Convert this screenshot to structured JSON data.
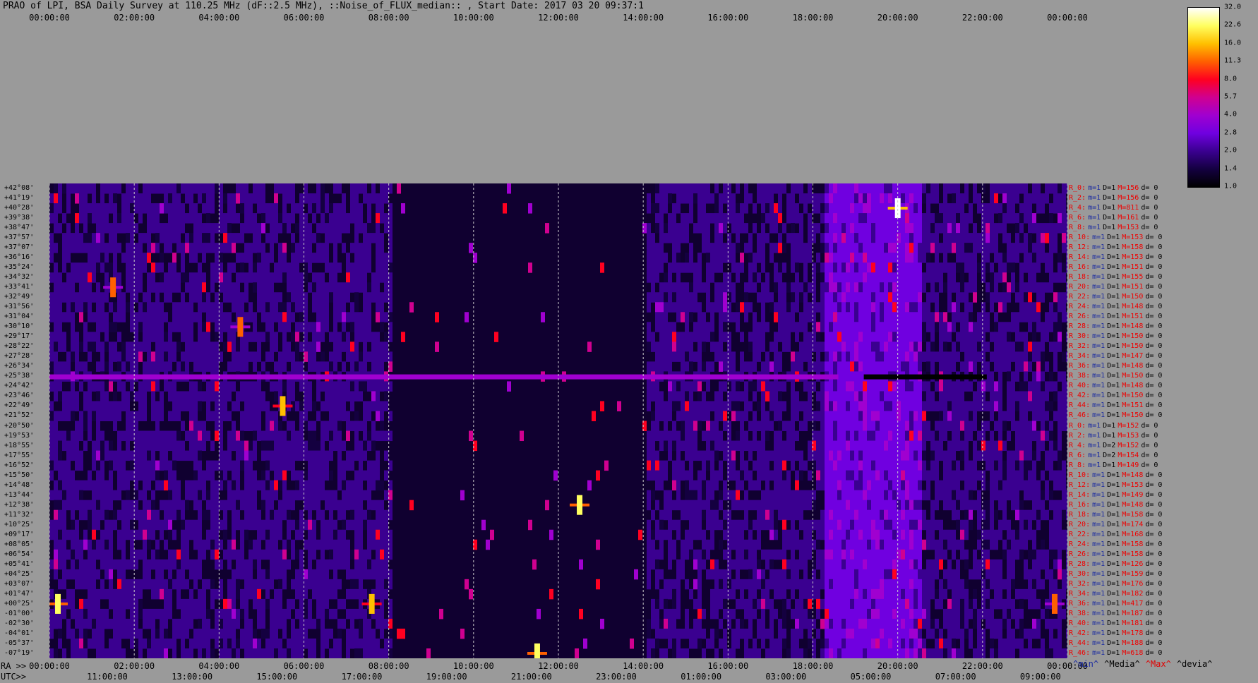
{
  "title": "PRAO of LPI, BSA Daily Survey at 110.25 MHz (dF::2.5 MHz), ::Noise_of_FLUX_median:: , Start Date: 2017 03 20 09:37:1",
  "chart_data": {
    "type": "heatmap",
    "x_top_ticks": [
      "00:00:00",
      "02:00:00",
      "04:00:00",
      "06:00:00",
      "08:00:00",
      "10:00:00",
      "12:00:00",
      "14:00:00",
      "16:00:00",
      "18:00:00",
      "20:00:00",
      "22:00:00",
      "00:00:00"
    ],
    "ra_label": "RA >>",
    "ra_ticks": [
      "00:00:00",
      "02:00:00",
      "04:00:00",
      "06:00:00",
      "08:00:00",
      "10:00:00",
      "12:00:00",
      "14:00:00",
      "16:00:00",
      "18:00:00",
      "20:00:00",
      "22:00:00",
      "00:00:00"
    ],
    "utc_label": "UTC>>",
    "utc_ticks": [
      "11:00:00",
      "13:00:00",
      "15:00:00",
      "17:00:00",
      "19:00:00",
      "21:00:00",
      "23:00:00",
      "01:00:00",
      "03:00:00",
      "05:00:00",
      "07:00:00",
      "09:00:00"
    ],
    "colorbar": {
      "ticks": [
        "32.0",
        "22.6",
        "16.0",
        "11.3",
        "8.0",
        "5.7",
        "4.0",
        "2.8",
        "2.0",
        "1.4",
        "1.0"
      ],
      "colors": [
        "#ffffff",
        "#ffff60",
        "#ffc000",
        "#ff6000",
        "#ff0020",
        "#d00090",
        "#a000d0",
        "#7000e0",
        "#3a0090",
        "#140040",
        "#000000"
      ]
    },
    "declinations": [
      "+42°08'",
      "+41°19'",
      "+40°28'",
      "+39°38'",
      "+38°47'",
      "+37°57'",
      "+37°07'",
      "+36°16'",
      "+35°24'",
      "+34°32'",
      "+33°41'",
      "+32°49'",
      "+31°56'",
      "+31°04'",
      "+30°10'",
      "+29°17'",
      "+28°22'",
      "+27°28'",
      "+26°34'",
      "+25°38'",
      "+24°42'",
      "+23°46'",
      "+22°49'",
      "+21°52'",
      "+20°50'",
      "+19°53'",
      "+18°55'",
      "+17°55'",
      "+16°52'",
      "+15°50'",
      "+14°48'",
      "+13°44'",
      "+12°38'",
      "+11°32'",
      "+10°25'",
      "+09°17'",
      "+08°05'",
      "+06°54'",
      "+05°41'",
      "+04°25'",
      "+03°07'",
      "+01°47'",
      "+00°25'",
      "-01°00'",
      "-02°30'",
      "-04°01'",
      "-05°37'",
      "-07°19'"
    ],
    "row_stats": [
      {
        "r": "R_0:",
        "m": "m=1",
        "d": "D=1",
        "M": "M=156",
        "dv": "d= 0"
      },
      {
        "r": "R_2:",
        "m": "m=1",
        "d": "D=1",
        "M": "M=156",
        "dv": "d= 0"
      },
      {
        "r": "R_4:",
        "m": "m=1",
        "d": "D=1",
        "M": "M=811",
        "dv": "d= 0"
      },
      {
        "r": "R_6:",
        "m": "m=1",
        "d": "D=1",
        "M": "M=161",
        "dv": "d= 0"
      },
      {
        "r": "R_8:",
        "m": "m=1",
        "d": "D=1",
        "M": "M=153",
        "dv": "d= 0"
      },
      {
        "r": "R_10:",
        "m": "m=1",
        "d": "D=1",
        "M": "M=153",
        "dv": "d= 0"
      },
      {
        "r": "R_12:",
        "m": "m=1",
        "d": "D=1",
        "M": "M=158",
        "dv": "d= 0"
      },
      {
        "r": "R_14:",
        "m": "m=1",
        "d": "D=1",
        "M": "M=153",
        "dv": "d= 0"
      },
      {
        "r": "R_16:",
        "m": "m=1",
        "d": "D=1",
        "M": "M=151",
        "dv": "d= 0"
      },
      {
        "r": "R_18:",
        "m": "m=1",
        "d": "D=1",
        "M": "M=155",
        "dv": "d= 0"
      },
      {
        "r": "R_20:",
        "m": "m=1",
        "d": "D=1",
        "M": "M=151",
        "dv": "d= 0"
      },
      {
        "r": "R_22:",
        "m": "m=1",
        "d": "D=1",
        "M": "M=150",
        "dv": "d= 0"
      },
      {
        "r": "R_24:",
        "m": "m=1",
        "d": "D=1",
        "M": "M=148",
        "dv": "d= 0"
      },
      {
        "r": "R_26:",
        "m": "m=1",
        "d": "D=1",
        "M": "M=151",
        "dv": "d= 0"
      },
      {
        "r": "R_28:",
        "m": "m=1",
        "d": "D=1",
        "M": "M=148",
        "dv": "d= 0"
      },
      {
        "r": "R_30:",
        "m": "m=1",
        "d": "D=1",
        "M": "M=150",
        "dv": "d= 0"
      },
      {
        "r": "R_32:",
        "m": "m=1",
        "d": "D=1",
        "M": "M=150",
        "dv": "d= 0"
      },
      {
        "r": "R_34:",
        "m": "m=1",
        "d": "D=1",
        "M": "M=147",
        "dv": "d= 0"
      },
      {
        "r": "R_36:",
        "m": "m=1",
        "d": "D=1",
        "M": "M=148",
        "dv": "d= 0"
      },
      {
        "r": "R_38:",
        "m": "m=1",
        "d": "D=1",
        "M": "M=150",
        "dv": "d= 0"
      },
      {
        "r": "R_40:",
        "m": "m=1",
        "d": "D=1",
        "M": "M=148",
        "dv": "d= 0"
      },
      {
        "r": "R_42:",
        "m": "m=1",
        "d": "D=1",
        "M": "M=150",
        "dv": "d= 0"
      },
      {
        "r": "R_44:",
        "m": "m=1",
        "d": "D=1",
        "M": "M=151",
        "dv": "d= 0"
      },
      {
        "r": "R_46:",
        "m": "m=1",
        "d": "D=1",
        "M": "M=150",
        "dv": "d= 0"
      },
      {
        "r": "R_0:",
        "m": "m=1",
        "d": "D=1",
        "M": "M=152",
        "dv": "d= 0"
      },
      {
        "r": "R_2:",
        "m": "m=1",
        "d": "D=1",
        "M": "M=153",
        "dv": "d= 0"
      },
      {
        "r": "R_4:",
        "m": "m=1",
        "d": "D=2",
        "M": "M=152",
        "dv": "d= 0"
      },
      {
        "r": "R_6:",
        "m": "m=1",
        "d": "D=2",
        "M": "M=154",
        "dv": "d= 0"
      },
      {
        "r": "R_8:",
        "m": "m=1",
        "d": "D=1",
        "M": "M=149",
        "dv": "d= 0"
      },
      {
        "r": "R_10:",
        "m": "m=1",
        "d": "D=1",
        "M": "M=148",
        "dv": "d= 0"
      },
      {
        "r": "R_12:",
        "m": "m=1",
        "d": "D=1",
        "M": "M=153",
        "dv": "d= 0"
      },
      {
        "r": "R_14:",
        "m": "m=1",
        "d": "D=1",
        "M": "M=149",
        "dv": "d= 0"
      },
      {
        "r": "R_16:",
        "m": "m=1",
        "d": "D=1",
        "M": "M=148",
        "dv": "d= 0"
      },
      {
        "r": "R_18:",
        "m": "m=1",
        "d": "D=1",
        "M": "M=158",
        "dv": "d= 0"
      },
      {
        "r": "R_20:",
        "m": "m=1",
        "d": "D=1",
        "M": "M=174",
        "dv": "d= 0"
      },
      {
        "r": "R_22:",
        "m": "m=1",
        "d": "D=1",
        "M": "M=168",
        "dv": "d= 0"
      },
      {
        "r": "R_24:",
        "m": "m=1",
        "d": "D=1",
        "M": "M=158",
        "dv": "d= 0"
      },
      {
        "r": "R_26:",
        "m": "m=1",
        "d": "D=1",
        "M": "M=158",
        "dv": "d= 0"
      },
      {
        "r": "R_28:",
        "m": "m=1",
        "d": "D=1",
        "M": "M=126",
        "dv": "d= 0"
      },
      {
        "r": "R_30:",
        "m": "m=1",
        "d": "D=1",
        "M": "M=159",
        "dv": "d= 0"
      },
      {
        "r": "R_32:",
        "m": "m=1",
        "d": "D=1",
        "M": "M=176",
        "dv": "d= 0"
      },
      {
        "r": "R_34:",
        "m": "m=1",
        "d": "D=1",
        "M": "M=182",
        "dv": "d= 0"
      },
      {
        "r": "R_36:",
        "m": "m=1",
        "d": "D=1",
        "M": "M=417",
        "dv": "d= 0"
      },
      {
        "r": "R_38:",
        "m": "m=1",
        "d": "D=1",
        "M": "M=187",
        "dv": "d= 0"
      },
      {
        "r": "R_40:",
        "m": "m=1",
        "d": "D=1",
        "M": "M=181",
        "dv": "d= 0"
      },
      {
        "r": "R_42:",
        "m": "m=1",
        "d": "D=1",
        "M": "M=178",
        "dv": "d= 0"
      },
      {
        "r": "R_44:",
        "m": "m=1",
        "d": "D=1",
        "M": "M=188",
        "dv": "d= 0"
      },
      {
        "r": "R_46:",
        "m": "m=1",
        "d": "D=1",
        "M": "M=618",
        "dv": "d= 0"
      }
    ],
    "stat_legend": [
      "^min^",
      "^Media^",
      "^Max^",
      "^devia^"
    ],
    "stat_legend_colors": [
      "#1a2aa0",
      "#000000",
      "#e00000",
      "#000000"
    ],
    "features": [
      {
        "kind": "source",
        "ra_h": 20.0,
        "row": 2,
        "level": 32
      },
      {
        "kind": "source",
        "ra_h": 12.5,
        "row": 32,
        "level": 22.6
      },
      {
        "kind": "source",
        "ra_h": 5.5,
        "row": 22,
        "level": 16
      },
      {
        "kind": "source",
        "ra_h": 1.5,
        "row": 10,
        "level": 11.3
      },
      {
        "kind": "source",
        "ra_h": 4.5,
        "row": 14,
        "level": 11.3
      },
      {
        "kind": "source",
        "ra_h": 0.2,
        "row": 42,
        "level": 22.6
      },
      {
        "kind": "source",
        "ra_h": 7.6,
        "row": 42,
        "level": 16
      },
      {
        "kind": "source",
        "ra_h": 11.5,
        "row": 47,
        "level": 22.6
      },
      {
        "kind": "source",
        "ra_h": 23.7,
        "row": 42,
        "level": 11.3
      },
      {
        "kind": "hband",
        "row": 19,
        "ra_start": 0,
        "ra_end": 18.6,
        "level": 4.0
      },
      {
        "kind": "hband",
        "row": 19,
        "ra_start": 19.2,
        "ra_end": 22.1,
        "level": 1.0
      }
    ]
  }
}
